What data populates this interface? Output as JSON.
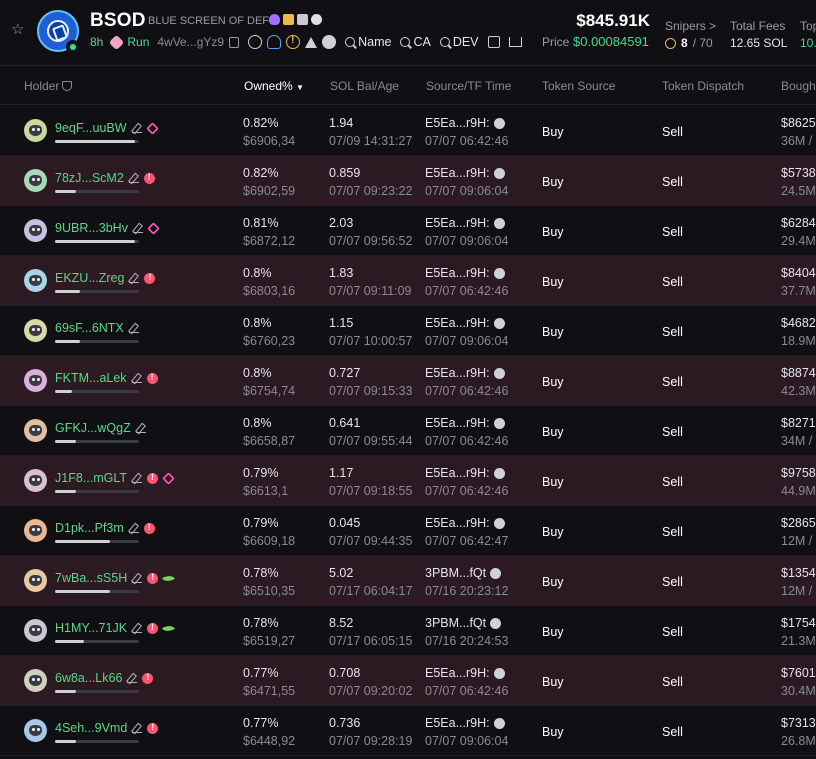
{
  "token": {
    "symbol": "BSOD",
    "full_name": "BLUE SCREEN OF DEFI",
    "age": "8h",
    "run_label": "Run",
    "contract_short": "4wVe...gYz9",
    "search_name": "Name",
    "search_ca": "CA",
    "search_dev": "DEV"
  },
  "stats": {
    "market_cap": "$845.91K",
    "price_label": "Price",
    "price_value": "$0.00084591",
    "snipers_label": "Snipers >",
    "snipers_count": "8",
    "snipers_total": "/ 70",
    "fees_label": "Total Fees",
    "fees_value": "12.65 SOL",
    "top_label": "Top",
    "top_value": "10."
  },
  "columns": {
    "holder": "Holder",
    "owned": "Owned%",
    "sol_bal": "SOL Bal/Age",
    "source": "Source/TF Time",
    "token_source": "Token Source",
    "token_dispatch": "Token Dispatch",
    "bought": "Bough"
  },
  "rows": [
    {
      "holder": "9eqF...uuBW",
      "badges": [
        "stack"
      ],
      "bar": 0.95,
      "pct": "0.82%",
      "usd": "$6906,34",
      "sol": "1.94",
      "sol_time": "07/09 14:31:27",
      "src": "E5Ea...r9H:",
      "src_time": "07/07 06:42:46",
      "buy": "Buy",
      "sell": "Sell",
      "bought": "$8625",
      "bought_sub": "36M / 1"
    },
    {
      "holder": "78zJ...ScM2",
      "badges": [
        "red"
      ],
      "bar": 0.25,
      "pct": "0.82%",
      "usd": "$6902,59",
      "sol": "0.859",
      "sol_time": "07/07 09:23:22",
      "src": "E5Ea...r9H:",
      "src_time": "07/07 09:06:04",
      "buy": "Buy",
      "sell": "Sell",
      "bought": "$5738",
      "bought_sub": "24.5M"
    },
    {
      "holder": "9UBR...3bHv",
      "badges": [
        "stack"
      ],
      "bar": 0.95,
      "pct": "0.81%",
      "usd": "$6872,12",
      "sol": "2.03",
      "sol_time": "07/07 09:56:52",
      "src": "E5Ea...r9H:",
      "src_time": "07/07 09:06:04",
      "buy": "Buy",
      "sell": "Sell",
      "bought": "$6284",
      "bought_sub": "29.4M"
    },
    {
      "holder": "EKZU...Zreg",
      "badges": [
        "red"
      ],
      "bar": 0.3,
      "pct": "0.8%",
      "usd": "$6803,16",
      "sol": "1.83",
      "sol_time": "07/07 09:11:09",
      "src": "E5Ea...r9H:",
      "src_time": "07/07 06:42:46",
      "buy": "Buy",
      "sell": "Sell",
      "bought": "$8404",
      "bought_sub": "37.7M"
    },
    {
      "holder": "69sF...6NTX",
      "badges": [],
      "bar": 0.3,
      "pct": "0.8%",
      "usd": "$6760,23",
      "sol": "1.15",
      "sol_time": "07/07 10:00:57",
      "src": "E5Ea...r9H:",
      "src_time": "07/07 09:06:04",
      "buy": "Buy",
      "sell": "Sell",
      "bought": "$4682",
      "bought_sub": "18.9M"
    },
    {
      "holder": "FKTM...aLek",
      "badges": [
        "red"
      ],
      "bar": 0.2,
      "pct": "0.8%",
      "usd": "$6754,74",
      "sol": "0.727",
      "sol_time": "07/07 09:15:33",
      "src": "E5Ea...r9H:",
      "src_time": "07/07 06:42:46",
      "buy": "Buy",
      "sell": "Sell",
      "bought": "$8874",
      "bought_sub": "42.3M"
    },
    {
      "holder": "GFKJ...wQgZ",
      "badges": [],
      "bar": 0.25,
      "pct": "0.8%",
      "usd": "$6658,87",
      "sol": "0.641",
      "sol_time": "07/07 09:55:44",
      "src": "E5Ea...r9H:",
      "src_time": "07/07 06:42:46",
      "buy": "Buy",
      "sell": "Sell",
      "bought": "$8271",
      "bought_sub": "34M / 1"
    },
    {
      "holder": "J1F8...mGLT",
      "badges": [
        "red",
        "stack"
      ],
      "bar": 0.25,
      "pct": "0.79%",
      "usd": "$6613,1",
      "sol": "1.17",
      "sol_time": "07/07 09:18:55",
      "src": "E5Ea...r9H:",
      "src_time": "07/07 06:42:46",
      "buy": "Buy",
      "sell": "Sell",
      "bought": "$9758",
      "bought_sub": "44.9M"
    },
    {
      "holder": "D1pk...Pf3m",
      "badges": [
        "red"
      ],
      "bar": 0.65,
      "pct": "0.79%",
      "usd": "$6609,18",
      "sol": "0.045",
      "sol_time": "07/07 09:44:35",
      "src": "E5Ea...r9H:",
      "src_time": "07/07 06:42:47",
      "buy": "Buy",
      "sell": "Sell",
      "bought": "$2865",
      "bought_sub": "12M / 1"
    },
    {
      "holder": "7wBa...sS5H",
      "badges": [
        "red",
        "leaf"
      ],
      "bar": 0.65,
      "pct": "0.78%",
      "usd": "$6510,35",
      "sol": "5.02",
      "sol_time": "07/17 06:04:17",
      "src": "3PBM...fQt",
      "src_time": "07/16 20:23:12",
      "buy": "Buy",
      "sell": "Sell",
      "bought": "$1354",
      "bought_sub": "12M / 1"
    },
    {
      "holder": "H1MY...71JK",
      "badges": [
        "red",
        "leaf"
      ],
      "bar": 0.35,
      "pct": "0.78%",
      "usd": "$6519,27",
      "sol": "8.52",
      "sol_time": "07/17 06:05:15",
      "src": "3PBM...fQt",
      "src_time": "07/16 20:24:53",
      "buy": "Buy",
      "sell": "Sell",
      "bought": "$1754",
      "bought_sub": "21.3M"
    },
    {
      "holder": "6w8a...Lk66",
      "badges": [
        "red"
      ],
      "bar": 0.25,
      "pct": "0.77%",
      "usd": "$6471,55",
      "sol": "0.708",
      "sol_time": "07/07 09:20:02",
      "src": "E5Ea...r9H:",
      "src_time": "07/07 06:42:46",
      "buy": "Buy",
      "sell": "Sell",
      "bought": "$7601",
      "bought_sub": "30.4M"
    },
    {
      "holder": "4Seh...9Vmd",
      "badges": [
        "red"
      ],
      "bar": 0.25,
      "pct": "0.77%",
      "usd": "$6448,92",
      "sol": "0.736",
      "sol_time": "07/07 09:28:19",
      "src": "E5Ea...r9H:",
      "src_time": "07/07 09:06:04",
      "buy": "Buy",
      "sell": "Sell",
      "bought": "$7313",
      "bought_sub": "26.8M"
    }
  ]
}
